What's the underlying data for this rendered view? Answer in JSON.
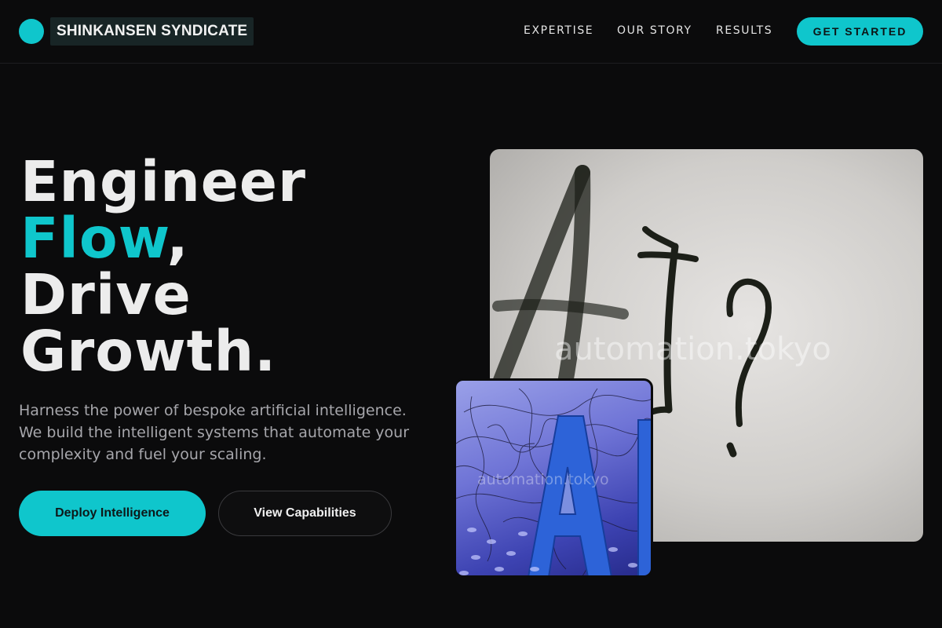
{
  "nav": {
    "brand": "SHINKANSEN SYNDICATE",
    "links": [
      "EXPERTISE",
      "OUR STORY",
      "RESULTS"
    ],
    "cta": "GET STARTED"
  },
  "hero": {
    "headline_line1": "Engineer",
    "headline_accent": "Flow",
    "headline_comma": ",",
    "headline_line3": "Drive",
    "headline_line4": "Growth.",
    "subtext": "Harness the power of bespoke artificial intelligence. We build the intelligent systems that automate your complexity and fuel your scaling.",
    "primary_button": "Deploy Intelligence",
    "secondary_button": "View Capabilities"
  },
  "images": {
    "main_watermark": "automation.tokyo",
    "small_watermark": "automation.tokyo"
  },
  "colors": {
    "accent": "#0fc6cc",
    "background": "#0b0b0c"
  }
}
